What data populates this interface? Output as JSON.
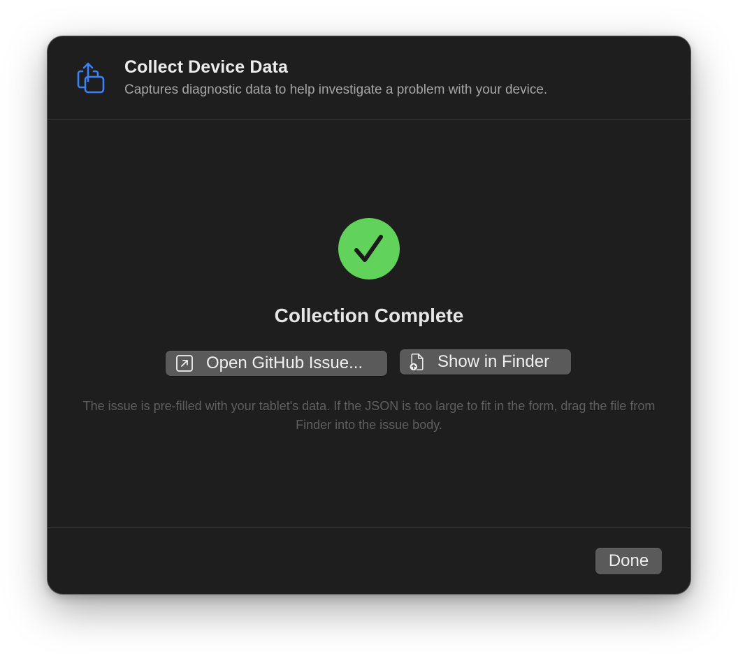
{
  "header": {
    "title": "Collect Device Data",
    "subtitle": "Captures diagnostic data to help investigate a problem with your device.",
    "icon": "share-stack-icon",
    "icon_color": "#3b82f6"
  },
  "status": {
    "icon": "checkmark-circle-icon",
    "icon_color": "#62d35a",
    "title": "Collection Complete"
  },
  "actions": {
    "github_label": "Open GitHub Issue...",
    "github_icon": "external-link-icon",
    "finder_label": "Show in Finder",
    "finder_icon": "document-arrow-icon"
  },
  "help_text": "The issue is pre-filled with your tablet's data. If the JSON is too large to fit in the form, drag the file from Finder into the issue body.",
  "footer": {
    "done_label": "Done"
  }
}
